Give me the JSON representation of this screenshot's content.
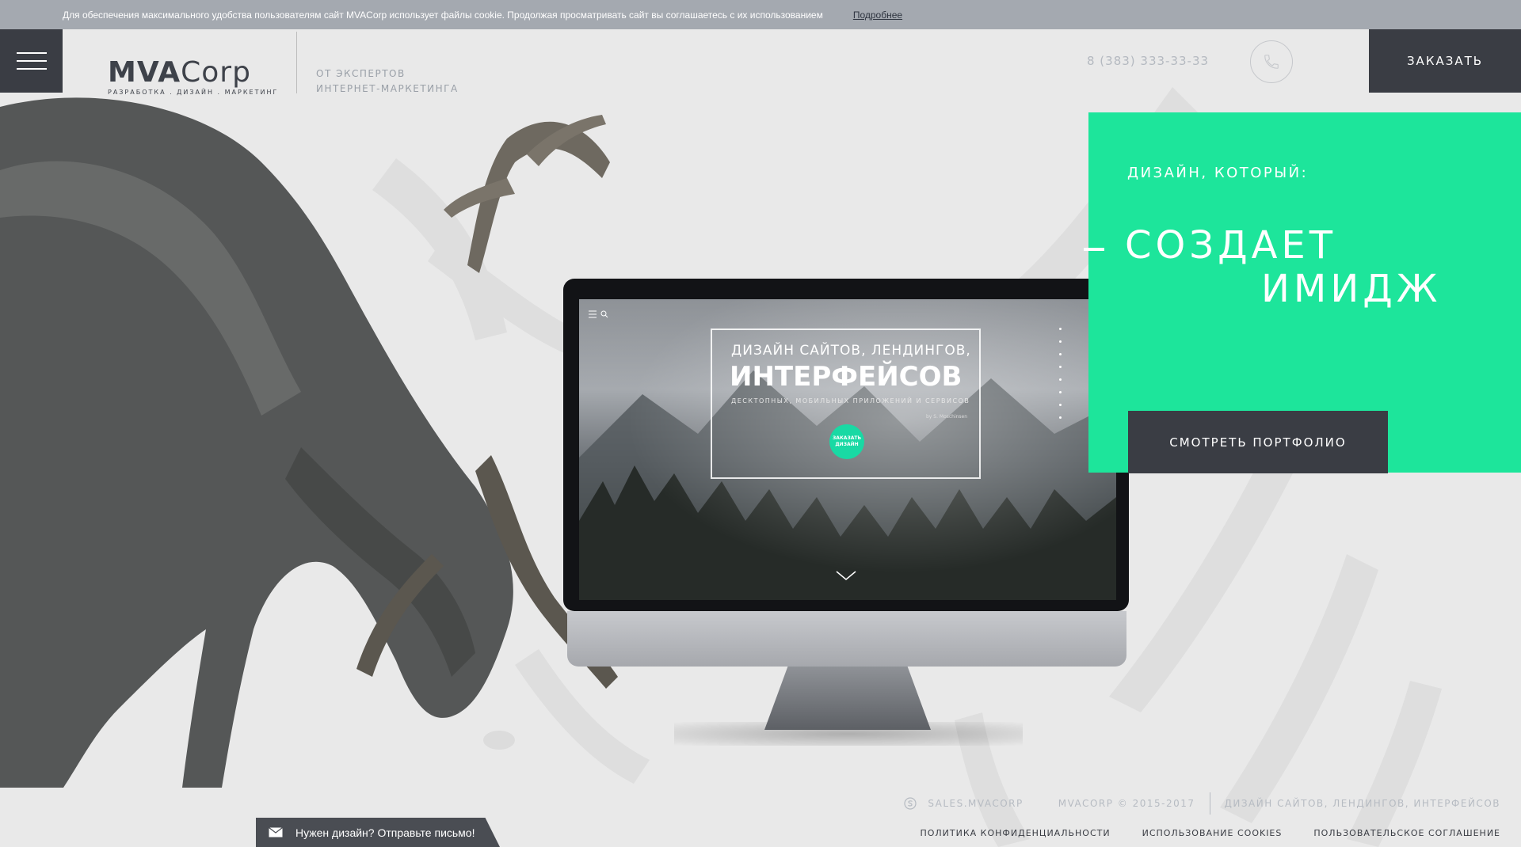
{
  "cookie": {
    "text": "Для обеспечения максимального удобства пользователям сайт MVACorp использует файлы cookie. Продолжая просматривать сайт вы соглашаетесь с их использованием",
    "more_link": "Подробнее"
  },
  "header": {
    "logo_main": "MVA",
    "logo_corp": "Corp",
    "logo_tagline": "Разработка . дизайн . маркетинг",
    "slogan_line1": "от экспертов",
    "slogan_line2": "интернет-маркетинга",
    "phone": "8 (383) 333-33-33",
    "order_label": "Заказать"
  },
  "monitor_screen": {
    "line1": "ДИЗАЙН САЙТОВ, ЛЕНДИНГОВ,",
    "line2": "ИНТЕРФЕЙСОВ",
    "line3": "ДЕСКТОПНЫХ, МОБИЛЬНЫХ ПРИЛОЖЕНИЙ И СЕРВИСОВ",
    "author": "by S. Moschinsen",
    "order_line1": "ЗАКАЗАТЬ",
    "order_line2": "ДИЗАЙН"
  },
  "hero": {
    "label": "Дизайн, который:",
    "title_line1": "создает",
    "title_line2": "имидж",
    "portfolio_label": "Смотреть портфолио"
  },
  "footer": {
    "skype": "sales.mvacorp",
    "copyright": "MVACorp © 2015-2017",
    "services": "Дизайн сайтов, лендингов, интерфейсов",
    "links": [
      "Политика конфиденциальности",
      "Использование cookies",
      "Пользовательское соглашение"
    ]
  },
  "chat": {
    "label": "Нужен дизайн? Отправьте письмо!"
  },
  "colors": {
    "accent": "#1de59b",
    "dark": "#3a3d44",
    "background": "#e9e9e9",
    "cookie_bar": "#a4a9b0"
  },
  "icons": [
    "menu-icon",
    "close-icon",
    "phone-icon",
    "skype-icon",
    "mail-icon",
    "chevron-down-icon"
  ]
}
